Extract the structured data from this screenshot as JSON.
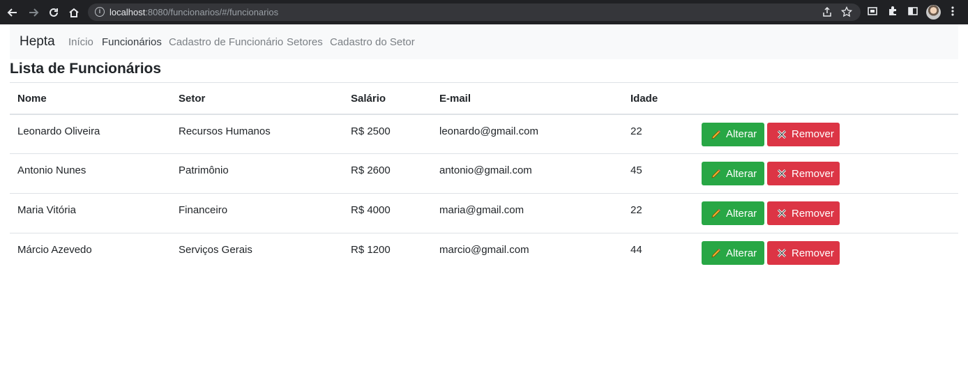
{
  "browser": {
    "url_host": "localhost",
    "url_rest": ":8080/funcionarios/#/funcionarios"
  },
  "navbar": {
    "brand": "Hepta",
    "links": [
      {
        "label": "Início",
        "active": false
      },
      {
        "label": "Funcionários",
        "active": true
      },
      {
        "label": "Cadastro de Funcionário",
        "active": false
      },
      {
        "label": "Setores",
        "active": false
      },
      {
        "label": "Cadastro do Setor",
        "active": false
      }
    ]
  },
  "page": {
    "title": "Lista de Funcionários"
  },
  "table": {
    "headers": [
      "Nome",
      "Setor",
      "Salário",
      "E-mail",
      "Idade"
    ],
    "rows": [
      {
        "nome": "Leonardo Oliveira",
        "setor": "Recursos Humanos",
        "salario": "R$ 2500",
        "email": "leonardo@gmail.com",
        "idade": "22"
      },
      {
        "nome": "Antonio Nunes",
        "setor": "Patrimônio",
        "salario": "R$ 2600",
        "email": "antonio@gmail.com",
        "idade": "45"
      },
      {
        "nome": "Maria Vitória",
        "setor": "Financeiro",
        "salario": "R$ 4000",
        "email": "maria@gmail.com",
        "idade": "22"
      },
      {
        "nome": "Márcio Azevedo",
        "setor": "Serviços Gerais",
        "salario": "R$ 1200",
        "email": "marcio@gmail.com",
        "idade": "44"
      }
    ],
    "edit_label": "Alterar",
    "remove_label": "Remover"
  },
  "colors": {
    "edit_button": "#28a745",
    "remove_button": "#dc3545",
    "navbar_bg": "#f8f9fa",
    "chrome_bg": "#202124"
  },
  "icons": {
    "edit": "pencil-icon",
    "remove": "cross-mark-icon"
  }
}
